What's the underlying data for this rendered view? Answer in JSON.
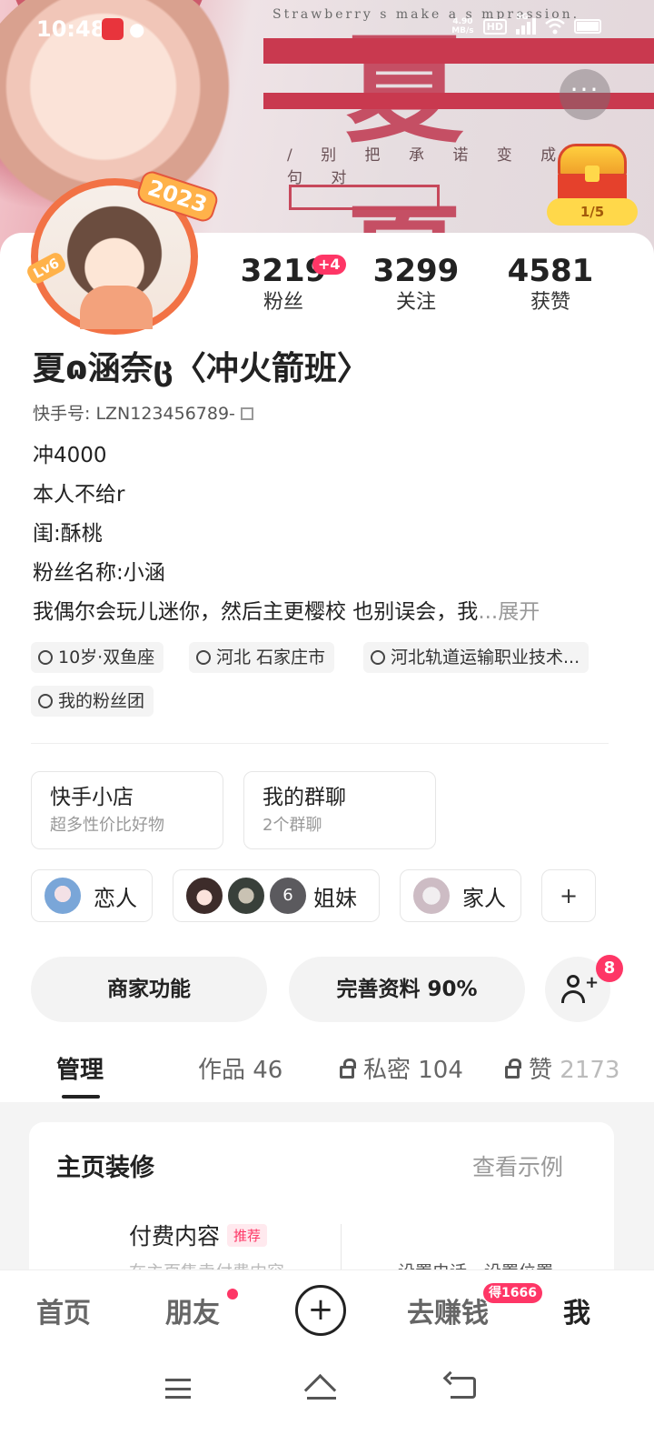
{
  "status_bar": {
    "time": "10:48",
    "net_speed_value": "4.90",
    "net_speed_unit": "MB/s",
    "hd": "HD",
    "network": "5G"
  },
  "banner": {
    "english_text": "Strawberry  s make a s    mpression.",
    "chinese_line": "/ 别 把 承 诺 变 成 一 句 对",
    "big_text": "夏 夏"
  },
  "treasure": {
    "progress": "1/5"
  },
  "avatar": {
    "year_badge": "2023",
    "level_badge": "Lv6"
  },
  "stats": [
    {
      "value": "3219",
      "label": "粉丝",
      "delta": "+4"
    },
    {
      "value": "3299",
      "label": "关注"
    },
    {
      "value": "4581",
      "label": "获赞"
    }
  ],
  "profile": {
    "nickname": "夏ɷ涵奈ც〈冲火箭班〉",
    "kuaishou_id": "快手号: LZN123456789-",
    "bio_lines": [
      "冲4000",
      "本人不给r",
      "闺:酥桃",
      "粉丝名称:小涵",
      "我偶尔会玩儿迷你，然后主更樱校 也别误会，我"
    ],
    "bio_ellipsis": "...",
    "bio_expand": "展开"
  },
  "tags": {
    "age_zodiac": "10岁·双鱼座",
    "location": "河北 石家庄市",
    "school": "河北轨道运输职业技术...",
    "fan_club": "我的粉丝团"
  },
  "services": [
    {
      "title": "快手小店",
      "subtitle": "超多性价比好物"
    },
    {
      "title": "我的群聊",
      "subtitle": "2个群聊"
    }
  ],
  "relations": {
    "lover": "恋人",
    "sisters": "姐妹",
    "sisters_count": "6",
    "family": "家人",
    "add": "+"
  },
  "actions": {
    "merchant": "商家功能",
    "complete_profile": "完善资料 90%",
    "add_friend_badge": "8"
  },
  "tabs": [
    {
      "label": "管理"
    },
    {
      "label": "作品 46"
    },
    {
      "label": "私密 104"
    },
    {
      "label": "赞",
      "count": "2173"
    }
  ],
  "decoration": {
    "title": "主页装修",
    "view_example": "查看示例",
    "paid_content": "付费内容",
    "recommended": "推荐",
    "paid_sub": "在主页售卖付费内容",
    "right_sub": "设置电话、设置位置"
  },
  "bottom_nav": {
    "home": "首页",
    "friends": "朋友",
    "earn": "去赚钱",
    "earn_badge": "得1666",
    "me": "我"
  }
}
